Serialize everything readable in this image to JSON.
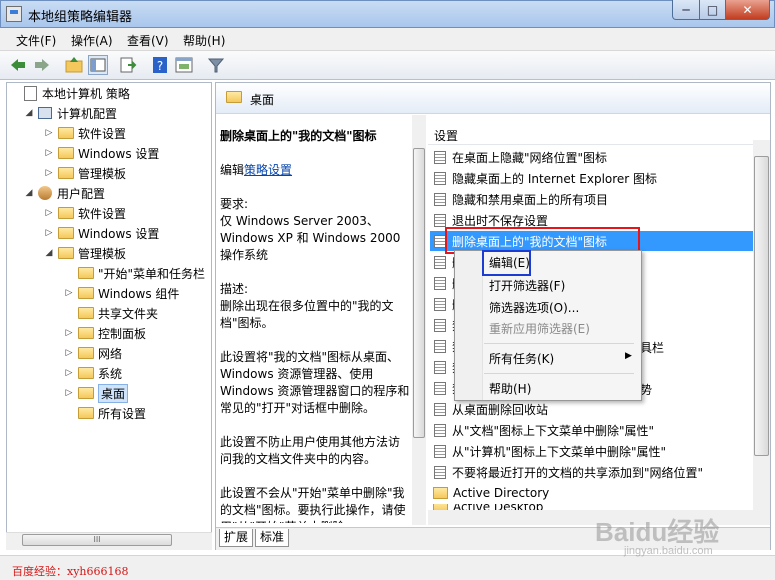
{
  "window": {
    "title": "本地组策略编辑器",
    "minimize": "─",
    "maximize": "□",
    "close": "✕"
  },
  "menu": [
    "文件(F)",
    "操作(A)",
    "查看(V)",
    "帮助(H)"
  ],
  "tree": {
    "items": [
      {
        "label": "本地计算机 策略",
        "level": 0,
        "icon": "doc-icon",
        "arrow": ""
      },
      {
        "label": "计算机配置",
        "level": 1,
        "icon": "computer-icon",
        "arrow": "◢"
      },
      {
        "label": "软件设置",
        "level": 2,
        "icon": "folder-icon",
        "arrow": "▷"
      },
      {
        "label": "Windows 设置",
        "level": 2,
        "icon": "folder-icon",
        "arrow": "▷"
      },
      {
        "label": "管理模板",
        "level": 2,
        "icon": "folder-icon",
        "arrow": "▷"
      },
      {
        "label": "用户配置",
        "level": 1,
        "icon": "user-icon",
        "arrow": "◢"
      },
      {
        "label": "软件设置",
        "level": 2,
        "icon": "folder-icon",
        "arrow": "▷"
      },
      {
        "label": "Windows 设置",
        "level": 2,
        "icon": "folder-icon",
        "arrow": "▷"
      },
      {
        "label": "管理模板",
        "level": 2,
        "icon": "folder-icon",
        "arrow": "◢"
      },
      {
        "label": "\"开始\"菜单和任务栏",
        "level": 3,
        "icon": "folder-icon",
        "arrow": ""
      },
      {
        "label": "Windows 组件",
        "level": 3,
        "icon": "folder-icon",
        "arrow": "▷"
      },
      {
        "label": "共享文件夹",
        "level": 3,
        "icon": "folder-icon",
        "arrow": ""
      },
      {
        "label": "控制面板",
        "level": 3,
        "icon": "folder-icon",
        "arrow": "▷"
      },
      {
        "label": "网络",
        "level": 3,
        "icon": "folder-icon",
        "arrow": "▷"
      },
      {
        "label": "系统",
        "level": 3,
        "icon": "folder-icon",
        "arrow": "▷"
      },
      {
        "label": "桌面",
        "level": 3,
        "icon": "folder-icon",
        "arrow": "▷",
        "selected": true
      },
      {
        "label": "所有设置",
        "level": 3,
        "icon": "folder-icon",
        "arrow": ""
      }
    ],
    "scroll_label": "III"
  },
  "right": {
    "header_title": "桌面",
    "description": {
      "title": "删除桌面上的\"我的文档\"图标",
      "edit_prefix": "编辑",
      "edit_link": "策略设置",
      "req_label": "要求:",
      "req_text": "仅 Windows Server 2003、Windows XP 和 Windows 2000 操作系统",
      "desc_label": "描述:",
      "desc_text": "删除出现在很多位置中的\"我的文档\"图标。",
      "p1": "此设置将\"我的文档\"图标从桌面、Windows 资源管理器、使用 Windows 资源管理器窗口的程序和常见的\"打开\"对话框中删除。",
      "p2": "此设置不防止用户使用其他方法访问我的文档文件夹中的内容。",
      "p3": "此设置不会从\"开始\"菜单中删除\"我的文档\"图标。要执行此操作，请使用\"从\"开始\"菜单中删除"
    },
    "settings_header": "设置",
    "settings_rows": [
      "在桌面上隐藏\"网络位置\"图标",
      "隐藏桌面上的 Internet Explorer 图标",
      "隐藏和禁用桌面上的所有项目",
      "退出时不保存设置",
      "删除桌面上的\"我的文档\"图标",
      "删",
      "删",
      "删",
      "禁",
      "禁",
      "禁",
      "禁",
      "从桌面删除回收站",
      "从\"文档\"图标上下文菜单中删除\"属性\"",
      "从\"计算机\"图标上下文菜单中删除\"属性\"",
      "不要将最近打开的文档的共享添加到\"网络位置\""
    ],
    "partial_text_1": "具栏",
    "partial_text_2": "势",
    "folder_row": "Active Directory",
    "folder_row_2": "Active Desktop",
    "tabs": [
      "扩展",
      "标准"
    ]
  },
  "context_menu": {
    "items": [
      {
        "label": "编辑(E)",
        "disabled": false
      },
      {
        "label": "打开筛选器(F)",
        "disabled": false
      },
      {
        "label": "筛选器选项(O)...",
        "disabled": false
      },
      {
        "label": "重新应用筛选器(E)",
        "disabled": true
      },
      {
        "label": "所有任务(K)",
        "disabled": false,
        "submenu": true
      },
      {
        "label": "帮助(H)",
        "disabled": false
      }
    ],
    "submenu_arrow": "▶"
  },
  "watermark": {
    "left": "百度经验：xyh666168",
    "logo": "Baidu经验",
    "url": "jingyan.baidu.com"
  }
}
